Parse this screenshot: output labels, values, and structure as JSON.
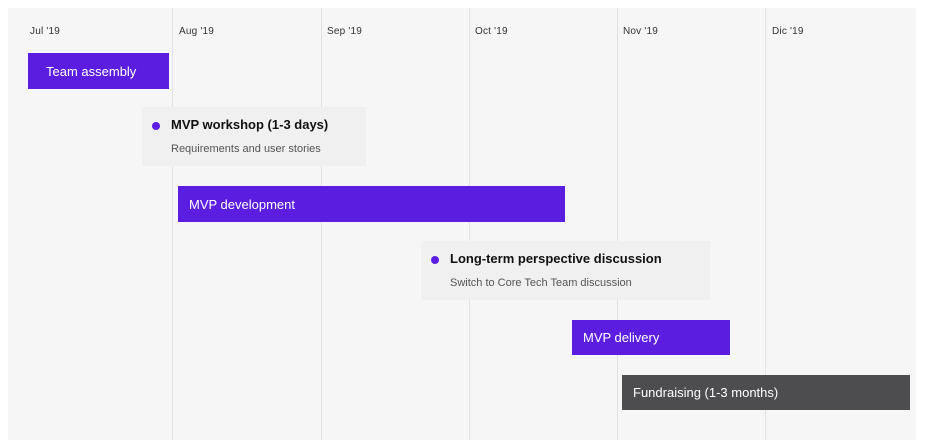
{
  "timeline": {
    "months": [
      "Jul '19",
      "Aug '19",
      "Sep '19",
      "Oct '19",
      "Nov '19",
      "Dic '19"
    ],
    "bars": [
      {
        "label": "Team assembly",
        "color": "#5b1ee1"
      },
      {
        "label": "MVP development",
        "color": "#5b1ee1"
      },
      {
        "label": "MVP delivery",
        "color": "#5b1ee1"
      },
      {
        "label": "Fundraising (1-3 months)",
        "color": "#4d4d4f"
      }
    ],
    "milestones": [
      {
        "title": "MVP workshop (1-3 days)",
        "subtitle": "Requirements and user stories"
      },
      {
        "title": "Long-term perspective discussion",
        "subtitle": "Switch to Core Tech Team discussion"
      }
    ]
  }
}
